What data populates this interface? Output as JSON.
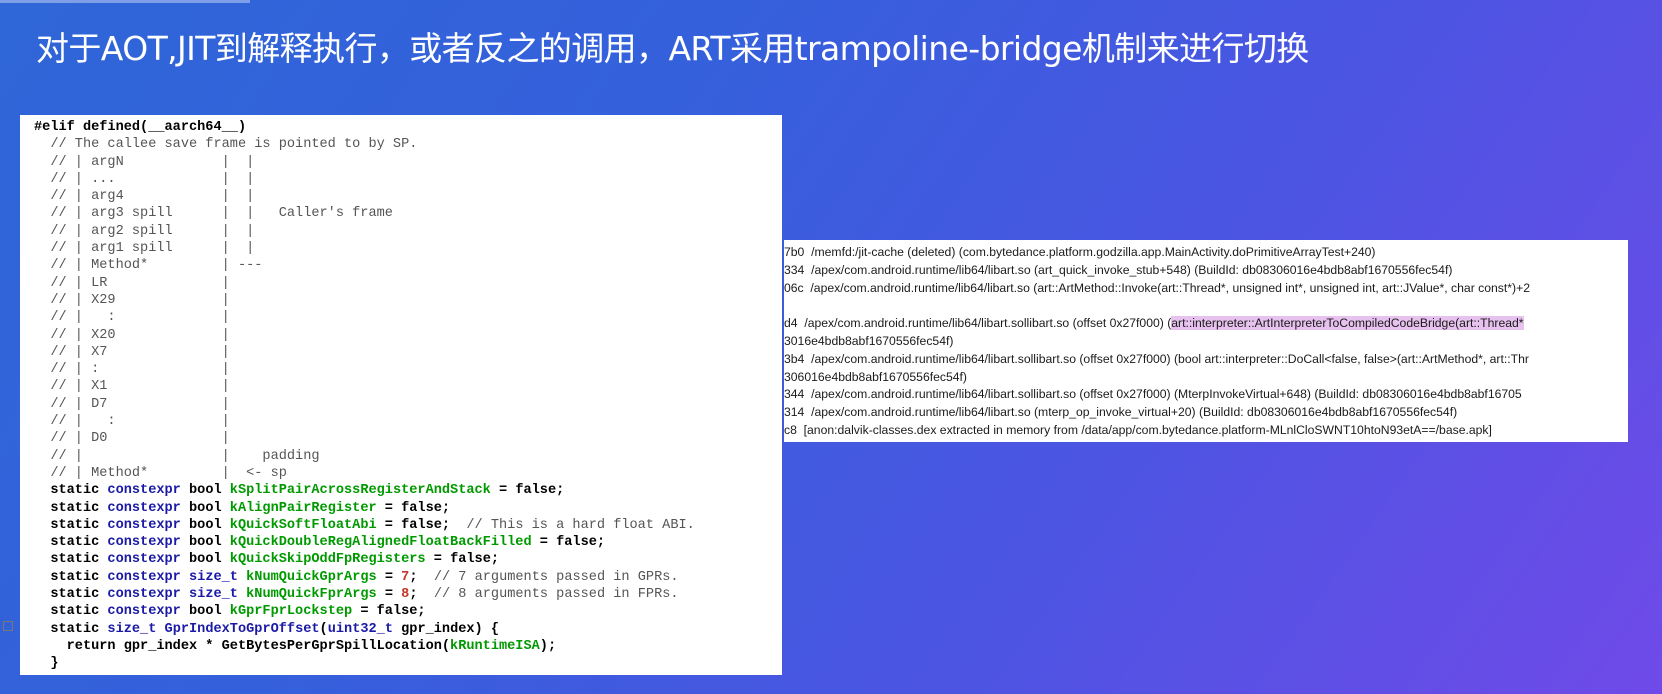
{
  "slide": {
    "title": "对于AOT,JIT到解释执行，或者反之的调用，ART采用trampoline-bridge机制来进行切换"
  },
  "code": {
    "fold_marker": "-",
    "lines": [
      "#elif defined(__aarch64__)",
      "  // The callee save frame is pointed to by SP.",
      "  // | argN            |  |",
      "  // | ...             |  |",
      "  // | arg4            |  |",
      "  // | arg3 spill      |  |   Caller's frame",
      "  // | arg2 spill      |  |",
      "  // | arg1 spill      |  |",
      "  // | Method*         | ---",
      "  // | LR              |",
      "  // | X29             |",
      "  // |   :             |",
      "  // | X20             |",
      "  // | X7              |",
      "  // | :               |",
      "  // | X1              |",
      "  // | D7              |",
      "  // |   :             |",
      "  // | D0              |",
      "  // |                 |    padding",
      "  // | Method*         |  <- sp",
      "  static constexpr bool kSplitPairAcrossRegisterAndStack = false;",
      "  static constexpr bool kAlignPairRegister = false;",
      "  static constexpr bool kQuickSoftFloatAbi = false;  // This is a hard float ABI.",
      "  static constexpr bool kQuickDoubleRegAlignedFloatBackFilled = false;",
      "  static constexpr bool kQuickSkipOddFpRegisters = false;",
      "  static constexpr size_t kNumQuickGprArgs = 7;  // 7 arguments passed in GPRs.",
      "  static constexpr size_t kNumQuickFprArgs = 8;  // 8 arguments passed in FPRs.",
      "  static constexpr bool kGprFprLockstep = false;",
      "  static size_t GprIndexToGprOffset(uint32_t gpr_index) {",
      "    return gpr_index * GetBytesPerGprSpillLocation(kRuntimeISA);",
      "  }"
    ]
  },
  "stack_trace": {
    "highlighted_text": "art::interpreter::ArtInterpreterToCompiledCodeBridge(art::Thread*",
    "lines": [
      "7b0  /memfd:/jit-cache (deleted) (com.bytedance.platform.godzilla.app.MainActivity.doPrimitiveArrayTest+240)",
      "334  /apex/com.android.runtime/lib64/libart.so (art_quick_invoke_stub+548) (BuildId: db08306016e4bdb8abf1670556fec54f)",
      "06c  /apex/com.android.runtime/lib64/libart.so (art::ArtMethod::Invoke(art::Thread*, unsigned int*, unsigned int, art::JValue*, char const*)+2",
      "",
      "d4  /apex/com.android.runtime/lib64/libart.sollibart.so (offset 0x27f000) (art::interpreter::ArtInterpreterToCompiledCodeBridge(art::Thread*",
      "3016e4bdb8abf1670556fec54f)",
      "3b4  /apex/com.android.runtime/lib64/libart.sollibart.so (offset 0x27f000) (bool art::interpreter::DoCall<false, false>(art::ArtMethod*, art::Thr",
      "306016e4bdb8abf1670556fec54f)",
      "344  /apex/com.android.runtime/lib64/libart.sollibart.so (offset 0x27f000) (MterpInvokeVirtual+648) (BuildId: db08306016e4bdb8abf16705",
      "314  /apex/com.android.runtime/lib64/libart.so (mterp_op_invoke_virtual+20) (BuildId: db08306016e4bdb8abf1670556fec54f)",
      "c8  [anon:dalvik-classes.dex extracted in memory from /data/app/com.bytedance.platform-MLnlCloSWNT10htoN93etA==/base.apk]"
    ]
  }
}
